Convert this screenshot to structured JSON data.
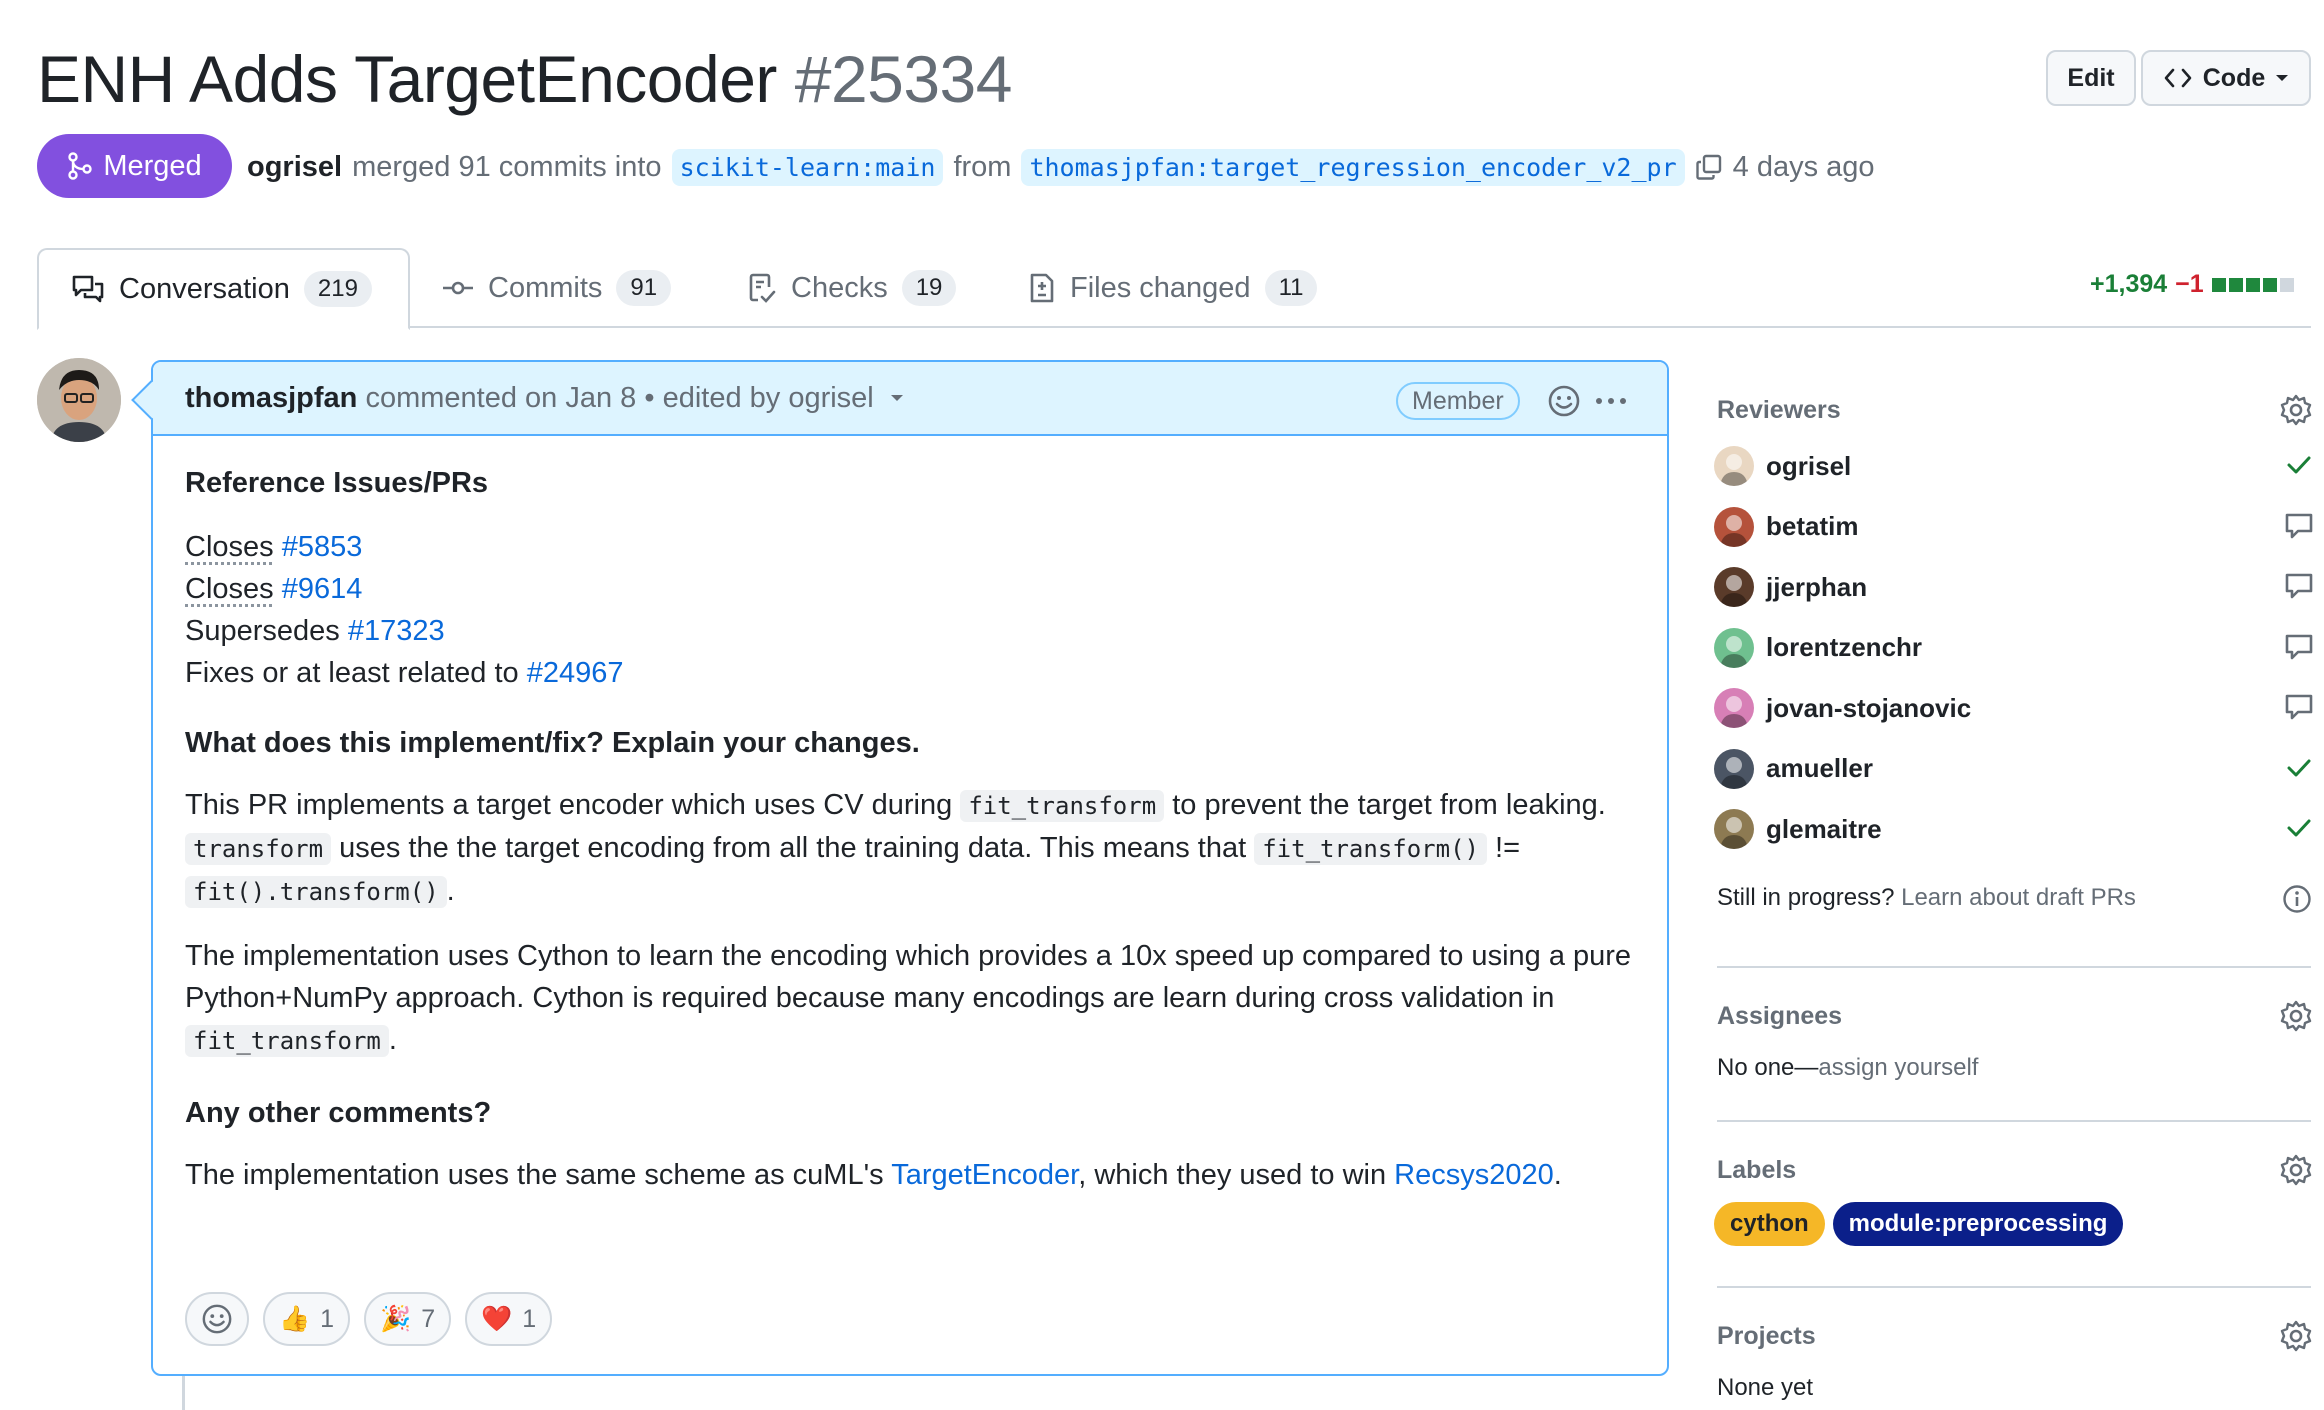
{
  "pr": {
    "title": "ENH Adds TargetEncoder",
    "number": "#25334",
    "state": "Merged",
    "merger": "ogrisel",
    "merge_text": "merged 91 commits into",
    "base_branch": "scikit-learn:main",
    "from_text": "from",
    "head_branch": "thomasjpfan:target_regression_encoder_v2_pr",
    "time": "4 days ago",
    "edit_label": "Edit",
    "code_label": "Code"
  },
  "tabs": [
    {
      "label": "Conversation",
      "count": "219"
    },
    {
      "label": "Commits",
      "count": "91"
    },
    {
      "label": "Checks",
      "count": "19"
    },
    {
      "label": "Files changed",
      "count": "11"
    }
  ],
  "diffstat": {
    "added": "+1,394",
    "removed": "−1"
  },
  "comment": {
    "author": "thomasjpfan",
    "meta": "commented on Jan 8 • edited by ogrisel",
    "role": "Member",
    "h_ref": "Reference Issues/PRs",
    "refs": [
      {
        "prefix": "Closes",
        "link": "#5853"
      },
      {
        "prefix": "Closes",
        "link": "#9614"
      },
      {
        "prefix": "Supersedes",
        "link": "#17323"
      },
      {
        "prefix": "Fixes or at least related to",
        "link": "#24967"
      }
    ],
    "h_what": "What does this implement/fix? Explain your changes.",
    "p1_a": "This PR implements a target encoder which uses CV during",
    "p1_code1": "fit_transform",
    "p1_b": "to prevent the target from leaking.",
    "p1_code2": "transform",
    "p1_c": "uses the the target encoding from all the training data. This means that",
    "p1_code3": "fit_transform()",
    "p1_d": "!=",
    "p1_code4": "fit().transform()",
    "p1_e": ".",
    "p2_a": "The implementation uses Cython to learn the encoding which provides a 10x speed up compared to using a pure Python+NumPy approach. Cython is required because many encodings are learn during cross validation in",
    "p2_code": "fit_transform",
    "p2_b": ".",
    "h_other": "Any other comments?",
    "p3_a": "The implementation uses the same scheme as cuML's",
    "p3_link1": "TargetEncoder",
    "p3_b": ", which they used to win",
    "p3_link2": "Recsys2020",
    "p3_c": ".",
    "reactions": [
      {
        "emoji": "👍",
        "count": "1"
      },
      {
        "emoji": "🎉",
        "count": "7"
      },
      {
        "emoji": "❤️",
        "count": "1"
      }
    ]
  },
  "sidebar": {
    "reviewers_h": "Reviewers",
    "reviewers": [
      {
        "name": "ogrisel",
        "status": "approved",
        "color": "#e9d7c2"
      },
      {
        "name": "betatim",
        "status": "commented",
        "color": "#b5523b"
      },
      {
        "name": "jjerphan",
        "status": "commented",
        "color": "#5a3b2a"
      },
      {
        "name": "lorentzenchr",
        "status": "commented",
        "color": "#6fc08f"
      },
      {
        "name": "jovan-stojanovic",
        "status": "commented",
        "color": "#d77fb6"
      },
      {
        "name": "amueller",
        "status": "approved",
        "color": "#4b5564"
      },
      {
        "name": "glemaitre",
        "status": "approved",
        "color": "#8d7a52"
      }
    ],
    "draft_q": "Still in progress?",
    "draft_link": "Learn about draft PRs",
    "assignees_h": "Assignees",
    "assignees_none": "No one—",
    "assignees_link": "assign yourself",
    "labels_h": "Labels",
    "labels": [
      {
        "name": "cython",
        "bg": "#f5b727",
        "fg": "#1f2328"
      },
      {
        "name": "module:preprocessing",
        "bg": "#0b1f8a",
        "fg": "#ffffff"
      }
    ],
    "projects_h": "Projects",
    "projects_none": "None yet"
  },
  "colors": {
    "merged": "#8250df",
    "accent": "#0969da",
    "success": "#1a7f37",
    "danger": "#cf222e"
  }
}
